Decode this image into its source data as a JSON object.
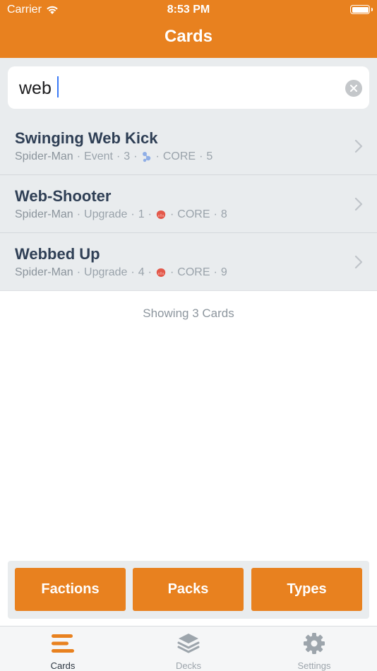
{
  "status_bar": {
    "carrier": "Carrier",
    "time": "8:53 PM"
  },
  "nav": {
    "title": "Cards"
  },
  "search": {
    "value": "web"
  },
  "cards": [
    {
      "title": "Swinging Web Kick",
      "hero": "Spider-Man",
      "type": "Event",
      "cost": "3",
      "resource": "energy-icon",
      "pack": "CORE",
      "number": "5"
    },
    {
      "title": "Web-Shooter",
      "hero": "Spider-Man",
      "type": "Upgrade",
      "cost": "1",
      "resource": "physical-icon",
      "pack": "CORE",
      "number": "8"
    },
    {
      "title": "Webbed Up",
      "hero": "Spider-Man",
      "type": "Upgrade",
      "cost": "4",
      "resource": "physical-icon",
      "pack": "CORE",
      "number": "9"
    }
  ],
  "separator": "·",
  "results": {
    "text": "Showing 3 Cards"
  },
  "filters": {
    "factions": "Factions",
    "packs": "Packs",
    "types": "Types"
  },
  "tabs": [
    {
      "label": "Cards",
      "icon": "cards-icon",
      "active": true
    },
    {
      "label": "Decks",
      "icon": "decks-icon",
      "active": false
    },
    {
      "label": "Settings",
      "icon": "gear-icon",
      "active": false
    }
  ],
  "colors": {
    "accent": "#e8811f",
    "energy": "#8faee6",
    "physical": "#e3584a",
    "title": "#2f3f55"
  }
}
